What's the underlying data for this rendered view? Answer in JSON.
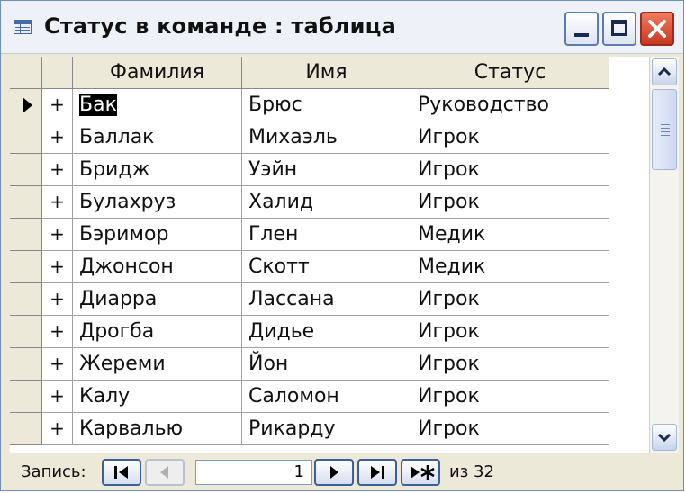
{
  "window": {
    "title": "Статус в команде : таблица"
  },
  "grid": {
    "columns": [
      "Фамилия",
      "Имя",
      "Статус"
    ],
    "expand_symbol": "+",
    "rows": [
      {
        "last_name": "Бак",
        "first_name": "Брюс",
        "status": "Руководство"
      },
      {
        "last_name": "Баллак",
        "first_name": "Михаэль",
        "status": "Игрок"
      },
      {
        "last_name": "Бридж",
        "first_name": "Уэйн",
        "status": "Игрок"
      },
      {
        "last_name": "Булахруз",
        "first_name": "Халид",
        "status": "Игрок"
      },
      {
        "last_name": "Бэримор",
        "first_name": "Глен",
        "status": "Медик"
      },
      {
        "last_name": "Джонсон",
        "first_name": "Скотт",
        "status": "Медик"
      },
      {
        "last_name": "Диарра",
        "first_name": "Лассана",
        "status": "Игрок"
      },
      {
        "last_name": "Дрогба",
        "first_name": "Дидье",
        "status": "Игрок"
      },
      {
        "last_name": "Жереми",
        "first_name": "Йон",
        "status": "Игрок"
      },
      {
        "last_name": "Калу",
        "first_name": "Саломон",
        "status": "Игрок"
      },
      {
        "last_name": "Карвалью",
        "first_name": "Рикарду",
        "status": "Игрок"
      }
    ],
    "selected_row": 0
  },
  "navigation": {
    "label": "Запись:",
    "current": "1",
    "total": "из 32",
    "icons": [
      "first-record-icon",
      "previous-record-icon",
      "next-record-icon",
      "last-record-icon",
      "new-record-icon"
    ]
  },
  "colors": {
    "selection": "#000000",
    "header_bg": "#ece9d8",
    "close_button": "#c43a22"
  }
}
